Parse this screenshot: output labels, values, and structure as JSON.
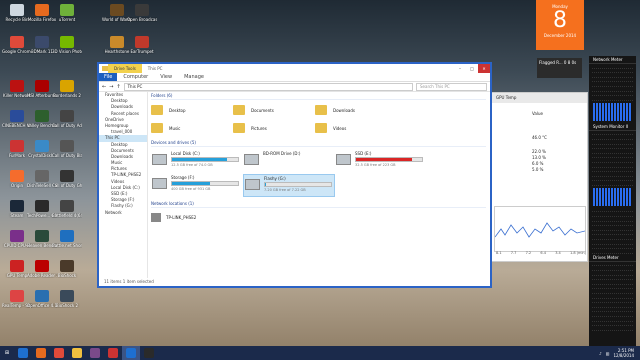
{
  "desktop_icons": [
    {
      "label": "Recycle Bin",
      "color": "#cfd8e0"
    },
    {
      "label": "Mozilla Firefox",
      "color": "#e66a1f"
    },
    {
      "label": "uTorrent",
      "color": "#6fb13a"
    },
    {
      "label": "World of Warcraft",
      "color": "#6b4a20"
    },
    {
      "label": "Open Broadcaster",
      "color": "#3a3a3a"
    },
    {
      "label": "Google Chrome",
      "color": "#e04a3a"
    },
    {
      "label": "3DMark 11",
      "color": "#3b4a6b"
    },
    {
      "label": "3D Vision Photo Viewer",
      "color": "#76b900"
    },
    {
      "label": "Hearthstone",
      "color": "#c98a2a"
    },
    {
      "label": "EarTrumpet",
      "color": "#c0392b"
    },
    {
      "label": "Killer Network",
      "color": "#b11"
    },
    {
      "label": "MSI Afterburner",
      "color": "#a00"
    },
    {
      "label": "Borderlands 2",
      "color": "#d9a400"
    },
    {
      "label": "CINEBENCH Windows 6...",
      "color": "#2a4c9a"
    },
    {
      "label": "Valley Benchma...",
      "color": "#2d5f2d"
    },
    {
      "label": "Call of Duty Advanced...",
      "color": "#444"
    },
    {
      "label": "FurMark",
      "color": "#c33"
    },
    {
      "label": "CrystalDiskI...",
      "color": "#3a8ac7"
    },
    {
      "label": "Call of Duty Black Ops",
      "color": "#555"
    },
    {
      "label": "Origin",
      "color": "#f56c2d"
    },
    {
      "label": "DishTeleSell - Shortcut",
      "color": "#666"
    },
    {
      "label": "Call of Duty Ghosts - ...",
      "color": "#333"
    },
    {
      "label": "Steam",
      "color": "#1b2838"
    },
    {
      "label": "TechPowe... GPU-Z",
      "color": "#2a2a2a"
    },
    {
      "label": "Battlefield 4(64 bit)",
      "color": "#444"
    },
    {
      "label": "CPUID CPU-Z",
      "color": "#7a2f8a"
    },
    {
      "label": "Heaven Benchma...",
      "color": "#2a4a3a"
    },
    {
      "label": "Battle.net Shortcut",
      "color": "#1f6fbf"
    },
    {
      "label": "GPU Temp",
      "color": "#c22"
    },
    {
      "label": "Adobe Reader XI",
      "color": "#b00"
    },
    {
      "label": "BioShock",
      "color": "#4a3a2a"
    },
    {
      "label": "RealTemp - Shortcut",
      "color": "#d44"
    },
    {
      "label": "OpenOffice 4.1.1",
      "color": "#2a6fb0"
    },
    {
      "label": "BioShock 2",
      "color": "#3a4a5a"
    }
  ],
  "explorer": {
    "drive_tools": "Drive Tools",
    "title": "This PC",
    "ribbon": {
      "file": "File",
      "tabs": [
        "Computer",
        "View",
        "Manage"
      ]
    },
    "address": "This PC",
    "search_placeholder": "Search This PC",
    "nav": [
      {
        "label": "Favorites",
        "sub": false
      },
      {
        "label": "Desktop",
        "sub": true
      },
      {
        "label": "Downloads",
        "sub": true
      },
      {
        "label": "Recent places",
        "sub": true
      },
      {
        "label": "OneDrive",
        "sub": false
      },
      {
        "label": "Homegroup",
        "sub": false
      },
      {
        "label": "travel_000",
        "sub": true
      },
      {
        "label": "This PC",
        "sub": false,
        "sel": true
      },
      {
        "label": "Desktop",
        "sub": true
      },
      {
        "label": "Documents",
        "sub": true
      },
      {
        "label": "Downloads",
        "sub": true
      },
      {
        "label": "Music",
        "sub": true
      },
      {
        "label": "Pictures",
        "sub": true
      },
      {
        "label": "TP-LINK_PHSE2",
        "sub": true
      },
      {
        "label": "Videos",
        "sub": true
      },
      {
        "label": "Local Disk (C:)",
        "sub": true
      },
      {
        "label": "SSD (E:)",
        "sub": true
      },
      {
        "label": "Storage (F:)",
        "sub": true
      },
      {
        "label": "Flashy (G:)",
        "sub": true
      },
      {
        "label": "Network",
        "sub": false
      }
    ],
    "folders_header": "Folders (6)",
    "folders": [
      "Desktop",
      "Documents",
      "Downloads",
      "Music",
      "Pictures",
      "Videos"
    ],
    "devices_header": "Devices and drives (5)",
    "drives": [
      {
        "name": "Local Disk (C:)",
        "free": "12.5 GB free of 74.0 GB",
        "fill": 0.83,
        "color": "#26a0da"
      },
      {
        "name": "BD-ROM Drive (D:)",
        "free": "",
        "fill": null,
        "color": "#26a0da"
      },
      {
        "name": "SSD (E:)",
        "free": "32.5 GB free of 223 GB",
        "fill": 0.85,
        "color": "#da2626"
      },
      {
        "name": "Storage (F:)",
        "free": "400 GB free of 931 GB",
        "fill": 0.57,
        "color": "#26a0da"
      },
      {
        "name": "Flashy (G:)",
        "free": "7.20 GB free of 7.22 GB",
        "fill": 0.01,
        "color": "#26a0da",
        "sel": true
      }
    ],
    "network_header": "Network locations (1)",
    "network": [
      "TP-LINK_PHSE2"
    ],
    "status": "11 items     1 item selected"
  },
  "gpu_temp": {
    "title": "GPU Temp",
    "value_header": "Value",
    "values": [
      "46.0 °C",
      "22.0 %",
      "13.0 %",
      "6.0 %",
      "5.0 %"
    ],
    "ticks": [
      "8.1",
      "7.7",
      "7.2",
      "6.4",
      "3.4",
      "1.8 (min)"
    ]
  },
  "calendar": {
    "weekday": "Monday",
    "day": "8",
    "month": "December 2014"
  },
  "flagged": "Flagged R... 0 8 0s",
  "gadgets": {
    "network_meter": "Network Meter",
    "system_monitor": "System Monitor II",
    "drives_meter": "Drives Meter"
  },
  "taskbar": {
    "apps": [
      {
        "color": "#1e6fd0"
      },
      {
        "color": "#e66a1f"
      },
      {
        "color": "#e04a3a"
      },
      {
        "color": "#f0c040"
      },
      {
        "color": "#7a4a8a"
      },
      {
        "color": "#c33"
      },
      {
        "color": "#1e6fd0"
      },
      {
        "color": "#2a2a2a"
      }
    ],
    "time": "2:51 PM",
    "date": "12/8/2014"
  }
}
